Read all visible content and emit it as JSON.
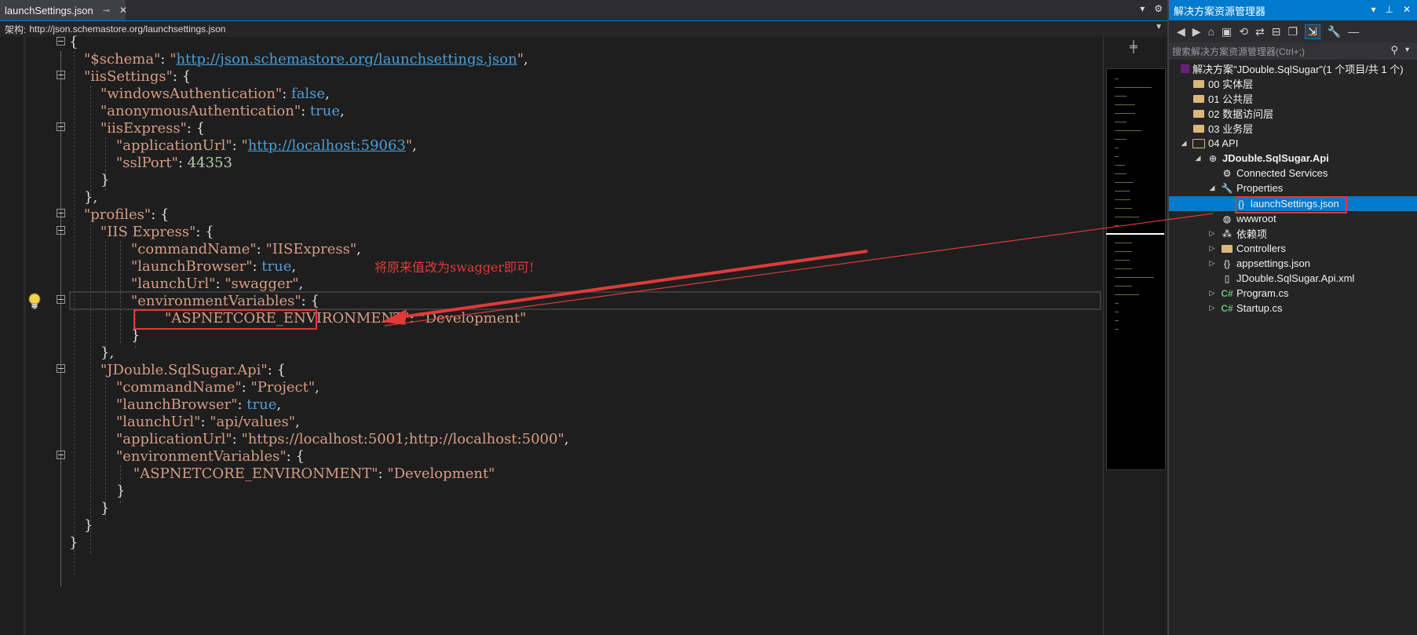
{
  "editor": {
    "tab_label": "launchSettings.json",
    "schema_label": "架构:",
    "schema_value": "http://json.schemastore.org/launchsettings.json",
    "annotation": "将原来值改为swagger即可!"
  },
  "explorer": {
    "title": "解决方案资源管理器",
    "search_placeholder": "搜索解决方案资源管理器(Ctrl+;)",
    "items": [
      {
        "label": "解决方案\"JDouble.SqlSugar\"(1 个项目/共 1 个)",
        "icon": "solution-icon"
      },
      {
        "label": "00 实体层",
        "icon": "folder-icon"
      },
      {
        "label": "01 公共层",
        "icon": "folder-icon"
      },
      {
        "label": "02 数据访问层",
        "icon": "folder-icon"
      },
      {
        "label": "03 业务层",
        "icon": "folder-icon"
      },
      {
        "label": "04 API",
        "icon": "folder-open-icon"
      },
      {
        "label": "JDouble.SqlSugar.Api",
        "icon": "web-project-icon"
      },
      {
        "label": "Connected Services",
        "icon": "connected-services-icon"
      },
      {
        "label": "Properties",
        "icon": "wrench-icon"
      },
      {
        "label": "launchSettings.json",
        "icon": "json-file-icon"
      },
      {
        "label": "wwwroot",
        "icon": "globe-icon"
      },
      {
        "label": "依赖项",
        "icon": "dependencies-icon"
      },
      {
        "label": "Controllers",
        "icon": "folder-icon"
      },
      {
        "label": "appsettings.json",
        "icon": "json-file-icon"
      },
      {
        "label": "JDouble.SqlSugar.Api.xml",
        "icon": "xml-file-icon"
      },
      {
        "label": "Program.cs",
        "icon": "csharp-file-icon"
      },
      {
        "label": "Startup.cs",
        "icon": "csharp-file-icon"
      }
    ]
  },
  "code_lines": [
    "{",
    "\"$schema\": \"http://json.schemastore.org/launchsettings.json\",",
    "\"iisSettings\": {",
    "\"windowsAuthentication\": false,",
    "\"anonymousAuthentication\": true,",
    "\"iisExpress\": {",
    "\"applicationUrl\": \"http://localhost:59063\",",
    "\"sslPort\": 44353",
    "}",
    "},",
    "\"profiles\": {",
    "\"IIS Express\": {",
    "\"commandName\": \"IISExpress\",",
    "\"launchBrowser\": true,",
    "\"launchUrl\": \"swagger\",",
    "\"environmentVariables\": {",
    "\"ASPNETCORE_ENVIRONMENT\": \"Development\"",
    "}",
    "},",
    "\"JDouble.SqlSugar.Api\": {",
    "\"commandName\": \"Project\",",
    "\"launchBrowser\": true,",
    "\"launchUrl\": \"api/values\",",
    "\"applicationUrl\": \"https://localhost:5001;http://localhost:5000\",",
    "\"environmentVariables\": {",
    "\"ASPNETCORE_ENVIRONMENT\": \"Development\"",
    "}",
    "}",
    "}",
    "}"
  ],
  "colors": {
    "accent": "#007acc",
    "string": "#d69d85",
    "keyword": "#569cd6",
    "number": "#b5cea8",
    "annotation_red": "#e03a3a"
  }
}
